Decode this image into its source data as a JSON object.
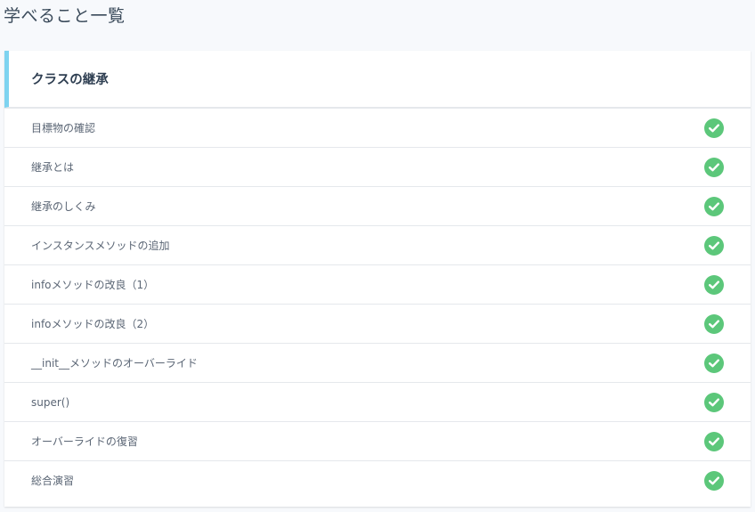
{
  "page": {
    "title": "学べること一覧"
  },
  "section": {
    "title": "クラスの継承",
    "accent_color": "#7dd3f0",
    "check_color": "#5cc77a",
    "items": [
      {
        "label": "目標物の確認",
        "completed": true
      },
      {
        "label": "継承とは",
        "completed": true
      },
      {
        "label": "継承のしくみ",
        "completed": true
      },
      {
        "label": "インスタンスメソッドの追加",
        "completed": true
      },
      {
        "label": "infoメソッドの改良（1）",
        "completed": true
      },
      {
        "label": "infoメソッドの改良（2）",
        "completed": true
      },
      {
        "label": "__init__メソッドのオーバーライド",
        "completed": true
      },
      {
        "label": "super()",
        "completed": true
      },
      {
        "label": "オーバーライドの復習",
        "completed": true
      },
      {
        "label": "総合演習",
        "completed": true
      }
    ]
  }
}
